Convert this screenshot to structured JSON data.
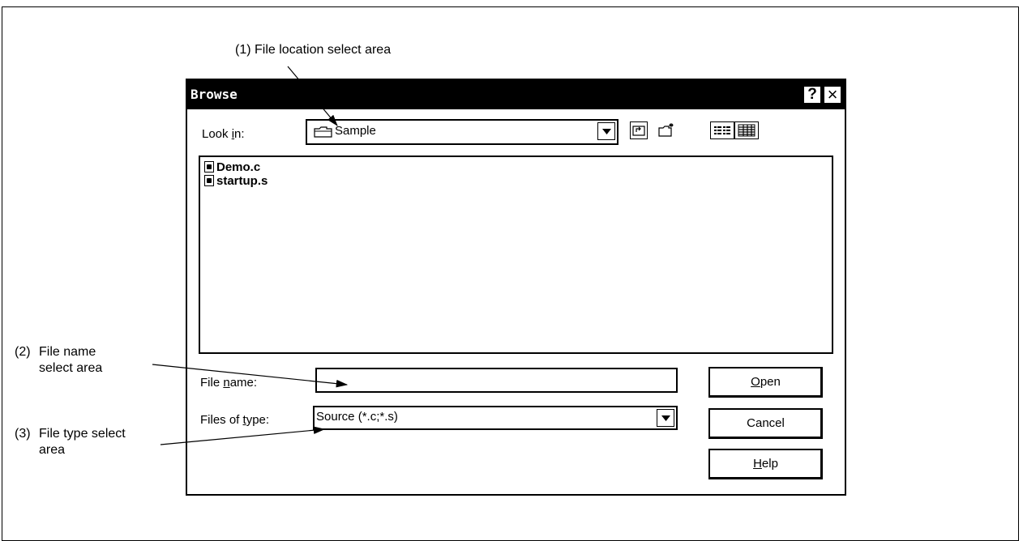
{
  "callouts": {
    "location": "(1) File location select area",
    "name_num": "(2)",
    "name_line1": "File name",
    "name_line2": "select area",
    "type_num": "(3)",
    "type_line1": "File type select",
    "type_line2": "area"
  },
  "dialog": {
    "title": "Browse",
    "help_button": "?",
    "close_button": "×",
    "look_in": {
      "label_prefix": "Look ",
      "label_accel": "i",
      "label_suffix": "n:",
      "value": "Sample",
      "icon": "folder-icon"
    },
    "toolbar": {
      "up_icon": "up-one-level-icon",
      "new_folder_icon": "new-folder-icon",
      "list_icon": "list-view-icon",
      "details_icon": "details-view-icon"
    },
    "files": [
      {
        "name": "Demo.c",
        "icon": "source-file-icon"
      },
      {
        "name": "startup.s",
        "icon": "source-file-icon"
      }
    ],
    "file_name": {
      "label_prefix": "File ",
      "label_accel": "n",
      "label_suffix": "ame:",
      "value": ""
    },
    "file_type": {
      "label_prefix": "Files of ",
      "label_accel": "t",
      "label_suffix": "ype:",
      "value": "Source (*.c;*.s)"
    },
    "buttons": {
      "open_accel": "O",
      "open_rest": "pen",
      "cancel": "Cancel",
      "help_accel": "H",
      "help_rest": "elp"
    }
  }
}
